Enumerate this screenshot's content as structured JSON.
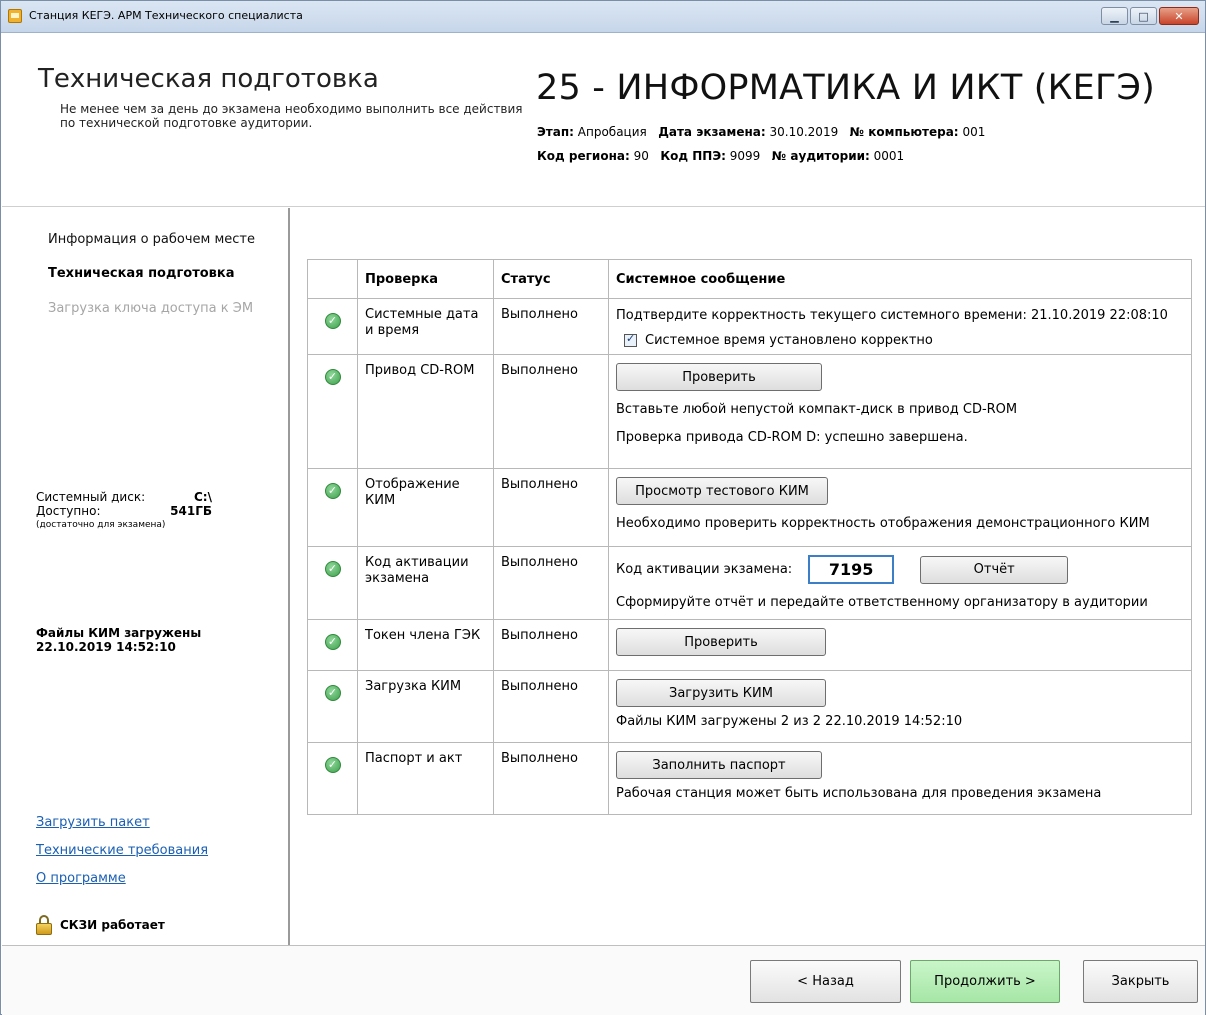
{
  "window": {
    "title": "Станция КЕГЭ. АРМ Технического специалиста",
    "controls": {
      "minimize": "▁",
      "maximize": "□",
      "close": "✕"
    }
  },
  "header": {
    "title": "Техническая подготовка",
    "subtitle": "Не менее чем за день до экзамена необходимо выполнить все действия по технической подготовке аудитории.",
    "exam_title": "25 - ИНФОРМАТИКА И ИКТ (КЕГЭ)",
    "stage_label": "Этап:",
    "stage_value": "Апробация",
    "date_label": "Дата экзамена:",
    "date_value": "30.10.2019",
    "computer_label": "№ компьютера:",
    "computer_value": "001",
    "region_label": "Код региона:",
    "region_value": "90",
    "ppe_label": "Код ППЭ:",
    "ppe_value": "9099",
    "room_label": "№ аудитории:",
    "room_value": "0001"
  },
  "sidebar": {
    "nav": {
      "info": "Информация о рабочем месте",
      "tech": "Техническая подготовка",
      "key": "Загрузка ключа доступа к ЭМ"
    },
    "disk": {
      "system_label": "Системный диск:",
      "system_value": "C:\\",
      "available_label": "Доступно:",
      "available_value": "541ГБ",
      "note": "(достаточно для экзамена)"
    },
    "kim_files_line1": "Файлы КИМ загружены",
    "kim_files_line2": "22.10.2019 14:52:10",
    "links": {
      "load_package": "Загрузить пакет",
      "tech_requirements": "Технические требования",
      "about": "О программе"
    },
    "skzi": "СКЗИ работает"
  },
  "table": {
    "headers": {
      "check": "Проверка",
      "status": "Статус",
      "message": "Системное сообщение"
    },
    "rows": {
      "datetime": {
        "name": "Системные дата и время",
        "status": "Выполнено",
        "msg": "Подтвердите корректность текущего системного времени: 21.10.2019 22:08:10",
        "checkbox_label": "Системное время установлено корректно"
      },
      "cdrom": {
        "name": "Привод CD-ROM",
        "status": "Выполнено",
        "button": "Проверить",
        "msg1": "Вставьте любой непустой компакт-диск в привод CD-ROM",
        "msg2": "Проверка привода CD-ROM D: успешно завершена."
      },
      "kim_display": {
        "name": "Отображение КИМ",
        "status": "Выполнено",
        "button": "Просмотр тестового КИМ",
        "msg": "Необходимо проверить корректность отображения демонстрационного КИМ"
      },
      "activation": {
        "name": "Код активации экзамена",
        "status": "Выполнено",
        "code_label": "Код активации экзамена:",
        "code_value": "7195",
        "button": "Отчёт",
        "msg": "Сформируйте отчёт и передайте ответственному организатору в аудитории"
      },
      "token": {
        "name": "Токен члена ГЭК",
        "status": "Выполнено",
        "button": "Проверить"
      },
      "kim_load": {
        "name": "Загрузка КИМ",
        "status": "Выполнено",
        "button": "Загрузить КИМ",
        "msg": "Файлы КИМ загружены 2 из 2 22.10.2019 14:52:10"
      },
      "passport": {
        "name": "Паспорт и акт",
        "status": "Выполнено",
        "button": "Заполнить паспорт",
        "msg": "Рабочая станция может быть использована для проведения экзамена"
      }
    }
  },
  "footer": {
    "back": "< Назад",
    "next": "Продолжить >",
    "close": "Закрыть"
  },
  "colors": {
    "accent_link": "#1a5fb4",
    "ok_green": "#3ea14d",
    "next_button": "#a6e6a6",
    "code_border": "#3c7fc7"
  }
}
